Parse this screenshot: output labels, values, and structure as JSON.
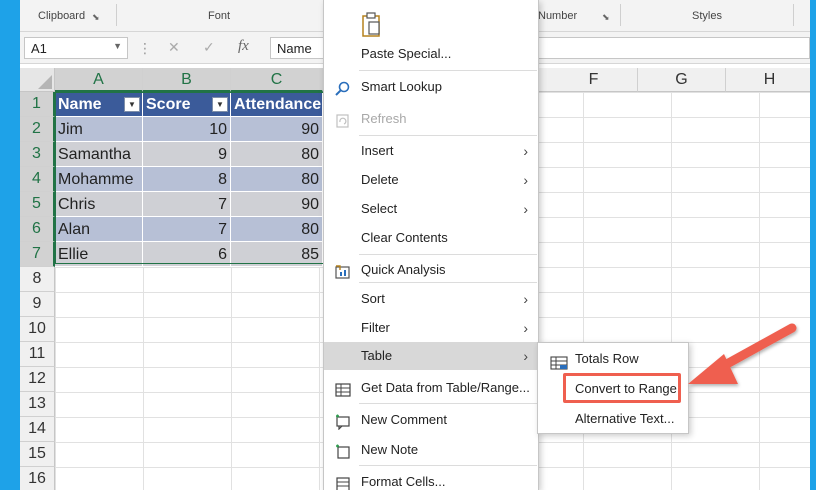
{
  "ribbon": {
    "groups": [
      "Clipboard",
      "Font",
      "Number",
      "Styles"
    ]
  },
  "formula_bar": {
    "name_box": "A1",
    "cancel_glyph": "✕",
    "enter_glyph": "✓",
    "fx_glyph": "fx",
    "content": "Name"
  },
  "columns": [
    "A",
    "B",
    "C",
    "F",
    "G",
    "H"
  ],
  "rows": [
    "1",
    "2",
    "3",
    "4",
    "5",
    "6",
    "7",
    "8",
    "9",
    "10",
    "11",
    "12",
    "13",
    "14",
    "15",
    "16"
  ],
  "table": {
    "headers": [
      "Name",
      "Score",
      "Attendance"
    ],
    "rows": [
      [
        "Jim",
        "10",
        "90"
      ],
      [
        "Samantha",
        "9",
        "80"
      ],
      [
        "Mohamme",
        "8",
        "80"
      ],
      [
        "Chris",
        "7",
        "90"
      ],
      [
        "Alan",
        "7",
        "80"
      ],
      [
        "Ellie",
        "6",
        "85"
      ]
    ]
  },
  "context_menu": {
    "paste_special": "Paste Special...",
    "smart_lookup": "Smart Lookup",
    "refresh": "Refresh",
    "insert": "Insert",
    "delete": "Delete",
    "select": "Select",
    "clear_contents": "Clear Contents",
    "quick_analysis": "Quick Analysis",
    "sort": "Sort",
    "filter": "Filter",
    "table": "Table",
    "get_data": "Get Data from Table/Range...",
    "new_comment": "New Comment",
    "new_note": "New Note",
    "format_cells": "Format Cells..."
  },
  "table_submenu": {
    "totals_row": "Totals Row",
    "convert_to_range": "Convert to Range",
    "alternative_text": "Alternative Text..."
  },
  "colors": {
    "frame": "#1ea2e8",
    "table_header": "#3b5b9a",
    "band_1": "#b7c0d6",
    "band_2": "#cfd0d5",
    "selection": "#217346",
    "callout": "#ef5f4f"
  },
  "icons": {
    "dropdown": "▼",
    "submenu_arrow": "›"
  }
}
